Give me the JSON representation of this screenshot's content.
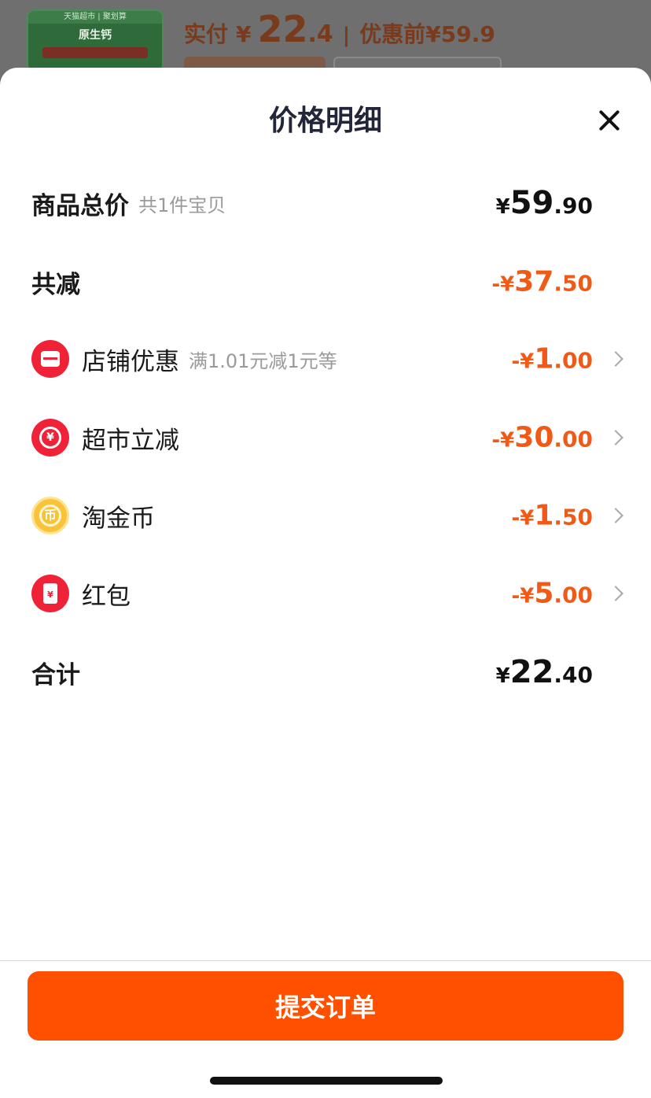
{
  "background": {
    "thumb_top": "天猫超市 | 聚划算",
    "thumb_name": "原生钙",
    "paid_label": "实付",
    "paid_symbol": "¥",
    "paid_int": "22",
    "paid_dec": ".4",
    "separator": "|",
    "original_label": "优惠前¥59.9"
  },
  "sheet": {
    "title": "价格明细",
    "close_icon": "close-icon"
  },
  "rows": {
    "total": {
      "label": "商品总价",
      "sub": "共1件宝贝",
      "symbol": "¥",
      "int": "59",
      "dec": ".90"
    },
    "reduced": {
      "label": "共减",
      "symbol": "-¥",
      "int": "37",
      "dec": ".50"
    },
    "store": {
      "icon": "store-icon",
      "label": "店铺优惠",
      "sub": "满1.01元减1元等",
      "symbol": "-¥",
      "int": "1",
      "dec": ".00"
    },
    "market": {
      "icon": "yuan-coupon-icon",
      "label": "超市立减",
      "symbol": "-¥",
      "int": "30",
      "dec": ".00"
    },
    "coin": {
      "icon": "gold-coin-icon",
      "label": "淘金币",
      "symbol": "-¥",
      "int": "1",
      "dec": ".50"
    },
    "redpacket": {
      "icon": "red-packet-icon",
      "label": "红包",
      "symbol": "-¥",
      "int": "5",
      "dec": ".00"
    },
    "sum": {
      "label": "合计",
      "symbol": "¥",
      "int": "22",
      "dec": ".40"
    }
  },
  "icon_glyphs": {
    "yuan": "¥",
    "coin": "币",
    "packet": "¥"
  },
  "footer": {
    "submit_label": "提交订单"
  },
  "colors": {
    "accent": "#ff5000",
    "discount": "#f05a16",
    "icon_red": "#f02238",
    "icon_gold": "#f8c33a"
  }
}
